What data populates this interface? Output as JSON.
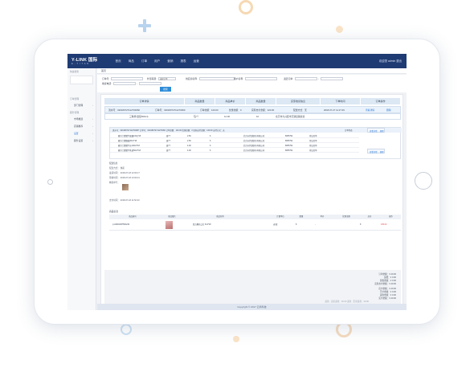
{
  "app": {
    "logo_main": "Y-LINK 国际",
    "logo_sub": "E - T I T A N",
    "nav": [
      "首页",
      "商品",
      "订单",
      "用户",
      "营销",
      "报表",
      "运营"
    ],
    "user_info": "欢迎您 admin 退出"
  },
  "sidebar": {
    "search_label": "快速搜索",
    "section1": "订单管理",
    "section2": "服务管理",
    "items": [
      "部门管理",
      "市场推选",
      "店铺推荐",
      "设置",
      "服务设置"
    ]
  },
  "breadcrumb": "首页",
  "filter": {
    "order_no_label": "订单号:",
    "channel_label": "外部来源:",
    "channel_value": "选择订单",
    "merchant_label": "供应商名称:",
    "buyer_label": "用户名称:",
    "date_label": "退还订单:",
    "date_sep": "-",
    "tel_label": "收货电话:",
    "search_button": "搜索"
  },
  "order_table": {
    "headers": [
      "订单详情",
      "商品数量",
      "商品单价",
      "商品数量",
      "买家收货信息",
      "下单时间",
      "订单操作"
    ],
    "order_no": "流水号：020180727112700060",
    "sub_no": "订单号：02018072711270060",
    "amount_paid": "订单金额：120.00",
    "discount": "优惠金额：0",
    "actual_paid": "实际支付金额：120.00",
    "pay_method": "配送方式：无",
    "order_time": "2018-07-27 11:27:49",
    "view_link": "查看详情",
    "delete_link": "删除",
    "product_name": "三联杯(套装500ml)",
    "product_spec": "包/个",
    "product_price": "12.00",
    "product_qty": "10",
    "address": "北京市大兴区市京通蓝路营商"
  },
  "sub_orders": {
    "header": "流水号：020180727112700087   订单号：02018072711270060   订单金额：120.00   优惠金额：0   实际支付金额：120.00   支付方式：无",
    "status_header": "订单状态",
    "view_link": "查看详情",
    "delete_link": "删除",
    "rows": [
      {
        "name": "雅诗兰黛精华面霜100g*18",
        "unit": "盒/个",
        "price": "2.50",
        "qty": "6",
        "supplier": "北京市供销超市有限公司",
        "code": "8055794",
        "state": "待出库单"
      },
      {
        "name": "雅诗兰黛眼霜15ml*18",
        "unit": "盒/个",
        "price": "2.50",
        "qty": "6",
        "supplier": "北京市供销超市有限公司",
        "code": "8055794",
        "state": "待出库单"
      },
      {
        "name": "雅诗兰黛精华水100ml*18",
        "unit": "盒/个",
        "price": "4.00",
        "qty": "6",
        "supplier": "北京市供销超市有限公司",
        "code": "8055794",
        "state": "待出库单"
      },
      {
        "name": "雅诗兰黛精华乳液50ml*18",
        "unit": "盒/个",
        "price": "4.00",
        "qty": "6",
        "supplier": "北京市供销超市有限公司",
        "code": "8055794",
        "state": "待出库单"
      }
    ]
  },
  "detail": {
    "title": "配送信息",
    "lines": [
      "配送方式：   快递",
      "发货时间：   2018-07-18 12:00:17",
      "签收时间：   2018-07-18 13:00:21",
      "物流单号："
    ],
    "pay_time": "支付时间：   2018-07-18 11:52:23"
  },
  "goods": {
    "title": "商品信息",
    "headers": [
      "商品编号",
      "商品图片",
      "商品名称",
      "",
      "计量单位",
      "数量",
      "单价",
      "优惠金额",
      "总价",
      "操作"
    ],
    "code": "p:ct0001387581232",
    "name": "复古雕花口红 6ml*18",
    "unit": "支/盒",
    "qty": "8",
    "price": "¥15.00",
    "total": "8",
    "discount_mark": "-"
  },
  "totals": {
    "lines": [
      "订单金额：¥ 40.00",
      "运费：¥ 0.00",
      "优惠金额：¥ 0.00",
      "实际支付金额：¥ 40.00"
    ],
    "red_lines": [
      "应付金额：¥ 40.00",
      "已付金额：¥ 0.00",
      "退款金额：¥ 0.00",
      "实付金额：¥ 40.00"
    ],
    "note": "退款 · 卖家退款：¥0.00  退款 · 买家退款：¥0.00"
  },
  "footer": "Copyright © 2017 云商科技",
  "colors": {
    "topbar": "#1f3b73",
    "accent": "#2f8cd8",
    "price_red": "#e04343"
  }
}
